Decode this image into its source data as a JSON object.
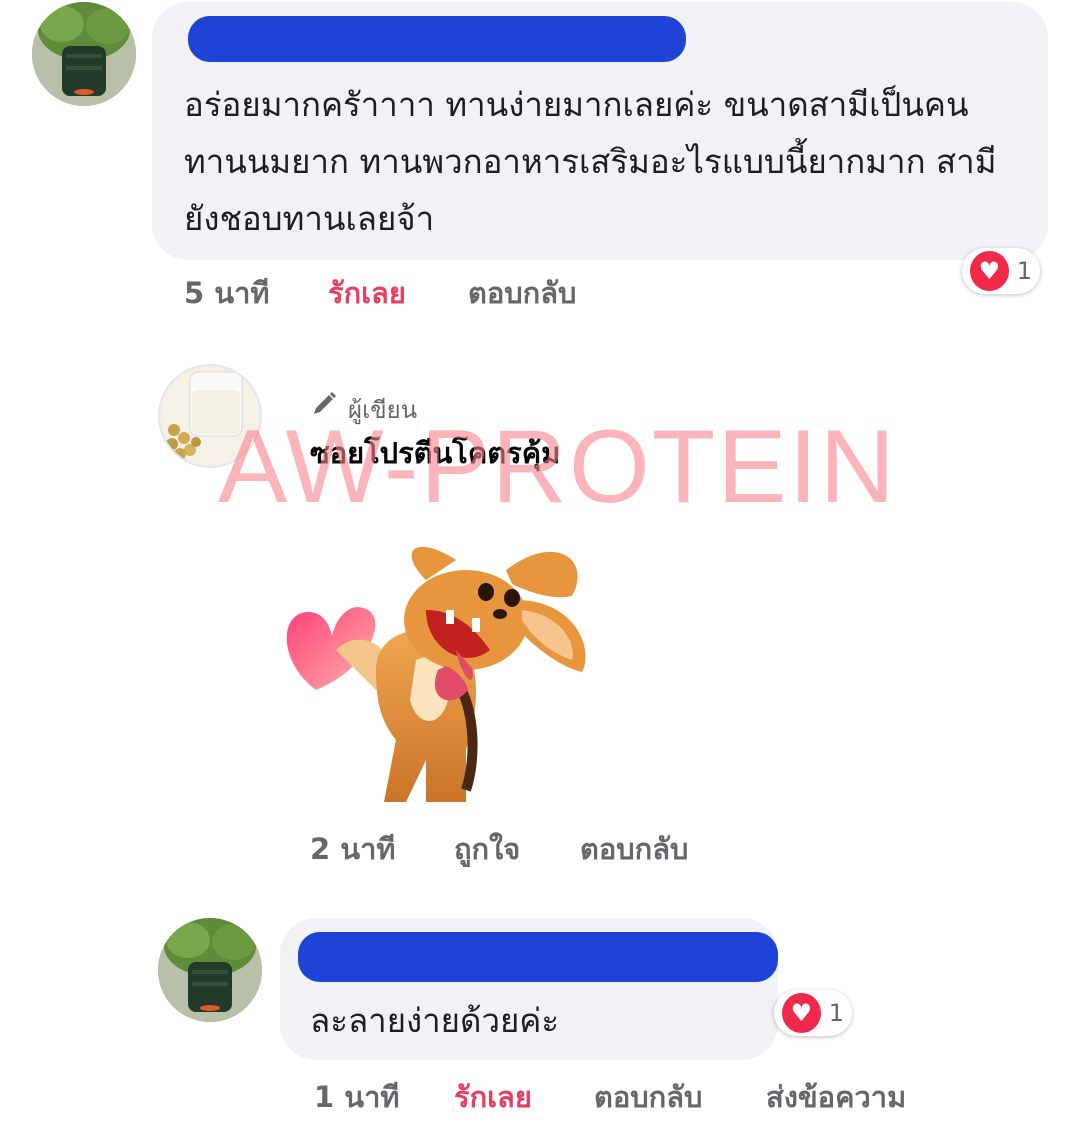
{
  "comments": [
    {
      "text": "อร่อยมากครัาาาา ทานง่ายมากเลยค่ะ ขนาดสามีเป็นคนทานนมยาก ทานพวกอาหารเสริมอะไรแบบนี้ยากมาก สามียังชอบทานเลยจ้า",
      "time": "5 นาที",
      "reaction_action": "รักเลย",
      "reply": "ตอบกลับ",
      "reaction_count": "1"
    },
    {
      "author_badge": "ผู้เขียน",
      "author_name": "ซอยโปรตีนโคตรคุ้ม",
      "time": "2 นาที",
      "reaction_action": "ถูกใจ",
      "reply": "ตอบกลับ"
    },
    {
      "text": "ละลายง่ายด้วยค่ะ",
      "time": "1 นาที",
      "reaction_action": "รักเลย",
      "reply": "ตอบกลับ",
      "message": "ส่งข้อความ",
      "reaction_count": "1"
    }
  ],
  "watermark": "AW-PROTEIN",
  "icons": {
    "author_badge": "pencil-icon",
    "reaction": "heart-reaction-icon",
    "sticker": "dog-with-heart-sticker"
  },
  "colors": {
    "bubble": "#f0f2f5",
    "loved": "#e4405f",
    "redaction": "#1f43d6",
    "muted": "#65676b"
  }
}
